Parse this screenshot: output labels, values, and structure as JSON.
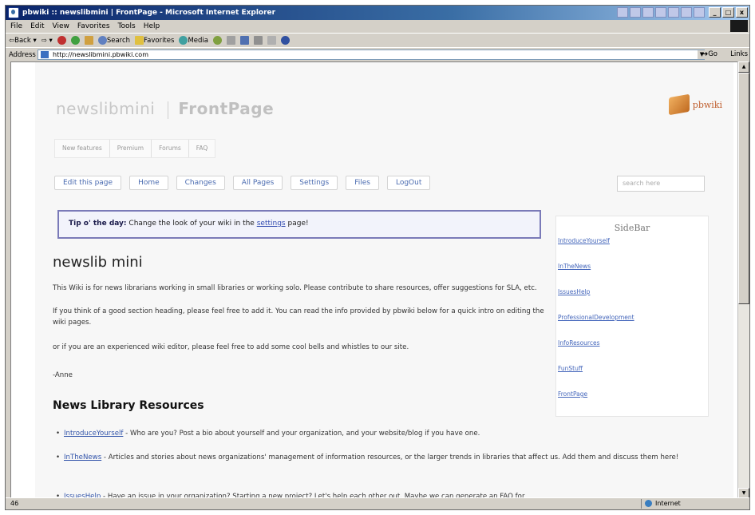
{
  "window": {
    "title": "pbwiki :: newslibmini | FrontPage - Microsoft Internet Explorer"
  },
  "menu": [
    "File",
    "Edit",
    "View",
    "Favorites",
    "Tools",
    "Help"
  ],
  "toolbar": {
    "back": "Back",
    "search": "Search",
    "favorites": "Favorites",
    "media": "Media"
  },
  "address": {
    "label": "Address",
    "url": "http://newslibmini.pbwiki.com",
    "go": "Go",
    "links": "Links"
  },
  "status": {
    "left": "46",
    "zone": "Internet"
  },
  "wiki": {
    "name": "newslibmini",
    "page": "FrontPage",
    "logo": "pbwiki",
    "subnav": [
      "New features",
      "Premium",
      "Forums",
      "FAQ"
    ],
    "actions": [
      "Edit this page",
      "Home",
      "Changes",
      "All Pages",
      "Settings",
      "Files",
      "LogOut"
    ],
    "search_placeholder": "search here",
    "tip_label": "Tip o' the day:",
    "tip_text": "Change the look of your wiki in the",
    "tip_link": "settings",
    "tip_end": "page!",
    "sidebar_title": "SideBar",
    "sidebar_links": [
      "IntroduceYourself",
      "InTheNews",
      "IssuesHelp",
      "ProfessionalDevelopment",
      "InfoResources",
      "FunStuff",
      "FrontPage"
    ],
    "heading": "newslib mini",
    "para1": "This Wiki is for news librarians working in small libraries or working solo. Please contribute to share resources, offer suggestions for SLA, etc.",
    "para2": "If you think of a good section heading, please feel free to add it. You can read the info provided by pbwiki below for a quick intro on editing the wiki pages.",
    "para3": "or if you are an experienced wiki editor, please feel free to add some cool bells and whistles to our site.",
    "signoff": "-Anne",
    "section_heading": "News Library Resources",
    "bullets": [
      {
        "link": "IntroduceYourself",
        "text": " - Who are you? Post a bio about yourself and your organization, and your website/blog if you have one."
      },
      {
        "link": "InTheNews",
        "text": " - Articles and stories about news organizations' management of information resources, or the larger trends in libraries that affect us. Add them and discuss them here!"
      },
      {
        "link": "IssuesHelp",
        "text": " - Have an issue in your organization? Starting a new project? Let's help each other out. Maybe we can generate an FAQ for"
      }
    ]
  }
}
